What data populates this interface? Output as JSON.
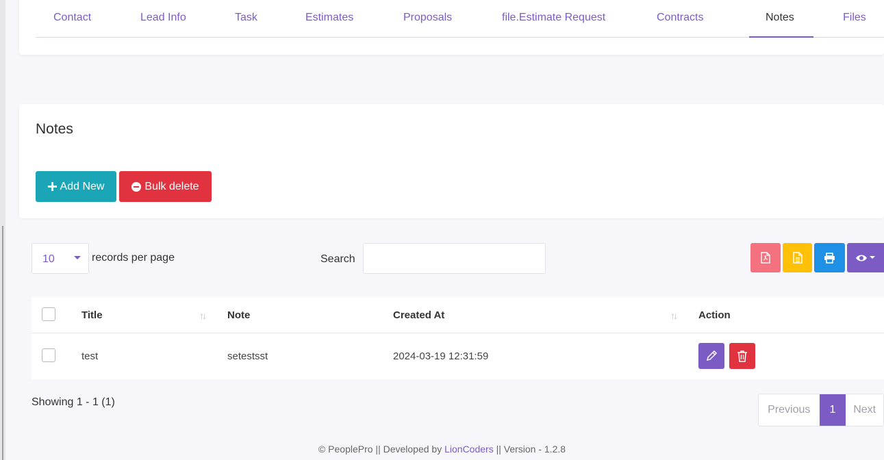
{
  "tabs": [
    {
      "label": "Contact"
    },
    {
      "label": "Lead Info"
    },
    {
      "label": "Task"
    },
    {
      "label": "Estimates"
    },
    {
      "label": "Proposals"
    },
    {
      "label": "file.Estimate Request"
    },
    {
      "label": "Contracts"
    },
    {
      "label": "Notes"
    },
    {
      "label": "Files"
    }
  ],
  "active_tab": "Notes",
  "notes": {
    "title": "Notes",
    "add_new_label": "Add New",
    "bulk_delete_label": "Bulk delete"
  },
  "table_controls": {
    "records_per_page_value": "10",
    "records_per_page_label": "records per page",
    "search_label": "Search",
    "search_value": "",
    "tool_icons": [
      "pdf-icon",
      "csv-icon",
      "print-icon",
      "eye-icon"
    ]
  },
  "table": {
    "columns": [
      "Title",
      "Note",
      "Created At",
      "Action"
    ],
    "rows": [
      {
        "title": "test",
        "note": "setestsst",
        "created_at": "2024-03-19 12:31:59"
      }
    ]
  },
  "showing": "Showing 1 - 1 (1)",
  "pagination": {
    "previous": "Previous",
    "current": "1",
    "next": "Next"
  },
  "footer": {
    "prefix": "© PeoplePro || Developed by",
    "link": "LionCoders",
    "suffix": "|| Version - 1.2.8"
  },
  "colors": {
    "accent": "#7c5cc4",
    "add_button": "#1ba6b8",
    "danger": "#e0323f",
    "pdf": "#f4727f",
    "csv": "#ffc107",
    "print": "#1e90e6"
  }
}
